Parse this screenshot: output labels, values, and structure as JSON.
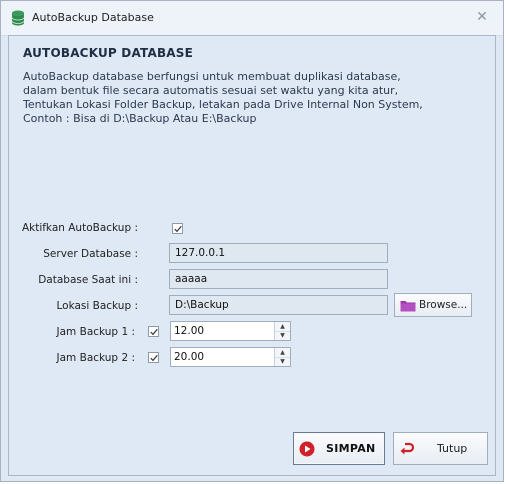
{
  "window": {
    "title": "AutoBackup Database"
  },
  "header": {
    "heading": "AUTOBACKUP DATABASE",
    "description": [
      "AutoBackup database berfungsi untuk membuat duplikasi database,",
      "dalam bentuk file secara automatis sesuai set waktu yang kita atur,",
      "Tentukan Lokasi Folder Backup, letakan pada Drive Internal Non System,",
      "Contoh : Bisa di D:\\Backup Atau E:\\Backup"
    ]
  },
  "form": {
    "aktifkan_label": "Aktifkan AutoBackup :",
    "aktifkan_checked": true,
    "server_label": "Server Database :",
    "server_value": "127.0.0.1",
    "database_label": "Database Saat ini :",
    "database_value": "aaaaa",
    "lokasi_label": "Lokasi Backup :",
    "lokasi_value": "D:\\Backup",
    "browse_label": "Browse...",
    "jam1_label": "Jam Backup 1 :",
    "jam1_checked": true,
    "jam1_value": "12.00",
    "jam2_label": "Jam Backup 2 :",
    "jam2_checked": true,
    "jam2_value": "20.00"
  },
  "buttons": {
    "simpan": "SIMPAN",
    "tutup": "Tutup"
  },
  "icons": {
    "app": "database-icon",
    "close": "close-icon",
    "browse": "folder-icon",
    "simpan": "save-record-icon",
    "tutup": "undo-arrow-icon"
  },
  "colors": {
    "accent_red": "#d0202a",
    "folder_purple": "#9b3aa8",
    "db_green": "#3a9a5b"
  }
}
